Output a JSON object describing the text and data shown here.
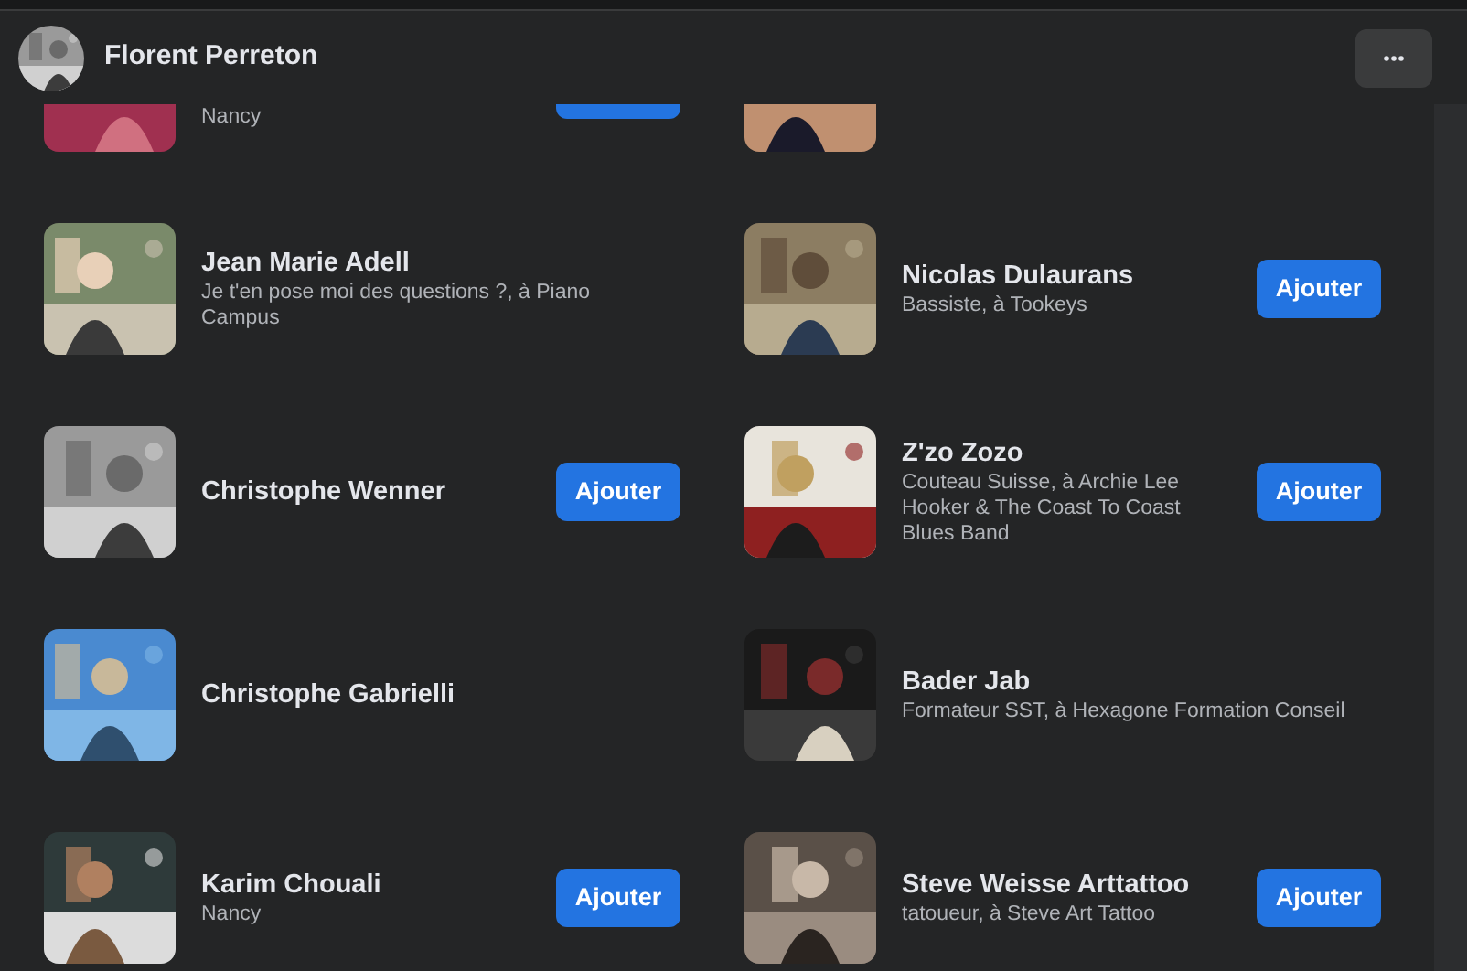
{
  "header": {
    "name": "Florent Perreton"
  },
  "partial_row": [
    {
      "subtitle": "Nancy",
      "has_button": true
    },
    {
      "has_button": false
    }
  ],
  "rows": [
    {
      "people": [
        {
          "name": "Jean Marie Adell",
          "subtitle": "Je t'en pose moi des questions ?, à Piano Campus",
          "kind": "picture"
        },
        {
          "name": "Nicolas Dulaurans",
          "subtitle": "Bassiste, à Tookeys",
          "button": "Ajouter",
          "kind": "picture"
        }
      ]
    },
    {
      "people": [
        {
          "name": "Christophe Wenner",
          "button": "Ajouter",
          "kind": "picture"
        },
        {
          "name": "Z'zo Zozo",
          "subtitle": "Couteau Suisse, à Archie Lee Hooker & The Coast To Coast Blues Band",
          "button": "Ajouter",
          "kind": "picture"
        }
      ]
    },
    {
      "people": [
        {
          "name": "Christophe Gabrielli",
          "kind": "picture"
        },
        {
          "name": "Bader Jab",
          "subtitle": "Formateur SST, à Hexagone Formation Conseil",
          "kind": "picture"
        }
      ]
    },
    {
      "people": [
        {
          "name": "Karim Chouali",
          "subtitle": "Nancy",
          "button": "Ajouter",
          "kind": "picture"
        },
        {
          "name": "Steve Weisse Arttattoo",
          "subtitle": "tatoueur, à Steve Art Tattoo",
          "button": "Ajouter",
          "kind": "picture"
        }
      ]
    }
  ]
}
